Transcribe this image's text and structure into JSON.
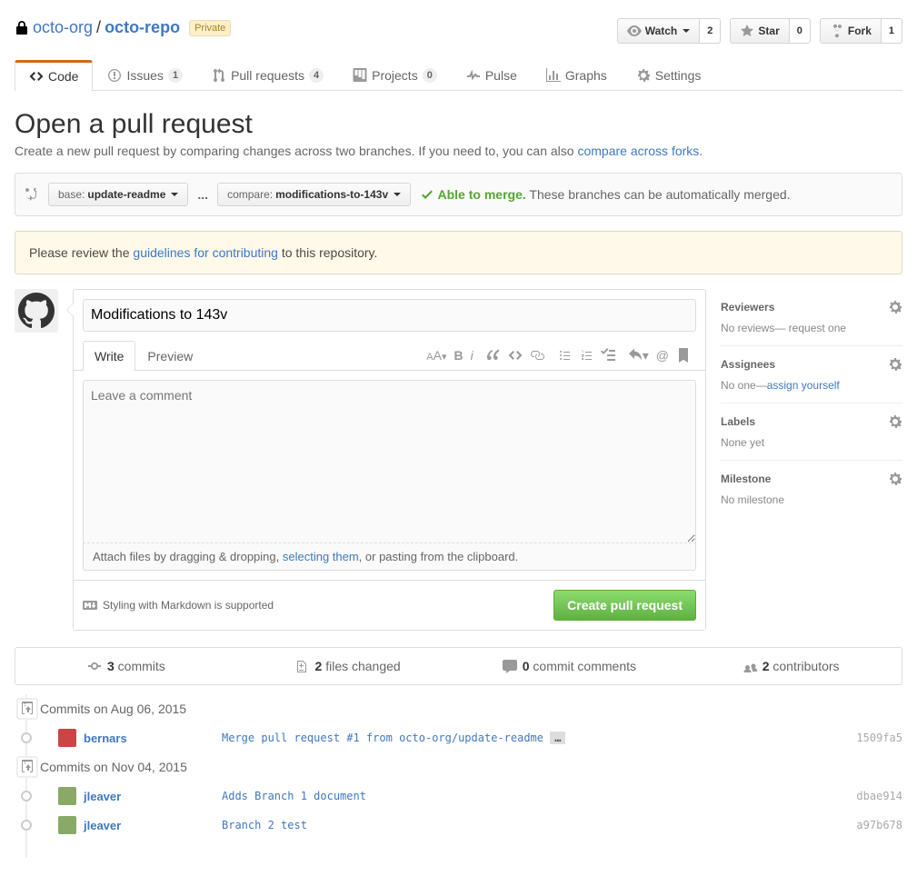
{
  "repo": {
    "owner": "octo-org",
    "name": "octo-repo",
    "privacy": "Private"
  },
  "actions": {
    "watch": {
      "label": "Watch",
      "count": "2"
    },
    "star": {
      "label": "Star",
      "count": "0"
    },
    "fork": {
      "label": "Fork",
      "count": "1"
    }
  },
  "nav": {
    "code": "Code",
    "issues": {
      "label": "Issues",
      "count": "1"
    },
    "pulls": {
      "label": "Pull requests",
      "count": "4"
    },
    "projects": {
      "label": "Projects",
      "count": "0"
    },
    "pulse": "Pulse",
    "graphs": "Graphs",
    "settings": "Settings"
  },
  "page": {
    "title": "Open a pull request",
    "subtitle_a": "Create a new pull request by comparing changes across two branches. If you need to, you can also ",
    "subtitle_link": "compare across forks",
    "subtitle_b": "."
  },
  "range": {
    "base_label": "base:",
    "base_value": "update-readme",
    "compare_label": "compare:",
    "compare_value": "modifications-to-143v",
    "dots": "...",
    "merge_ok": "Able to merge.",
    "merge_msg": "These branches can be automatically merged."
  },
  "flash": {
    "a": "Please review the ",
    "link": "guidelines for contributing",
    "b": " to this repository."
  },
  "form": {
    "title_value": "Modifications to 143v",
    "tab_write": "Write",
    "tab_preview": "Preview",
    "placeholder": "Leave a comment",
    "drag_a": "Attach files by dragging & dropping, ",
    "drag_link": "selecting them",
    "drag_b": ", or pasting from the clipboard.",
    "md_hint": "Styling with Markdown is supported",
    "submit": "Create pull request"
  },
  "sidebar": {
    "reviewers": {
      "title": "Reviewers",
      "body": "No reviews— request one"
    },
    "assignees": {
      "title": "Assignees",
      "body_a": "No one—",
      "body_link": "assign yourself"
    },
    "labels": {
      "title": "Labels",
      "body": "None yet"
    },
    "milestone": {
      "title": "Milestone",
      "body": "No milestone"
    }
  },
  "diffstat": {
    "commits": {
      "n": "3",
      "label": " commits"
    },
    "files": {
      "n": "2",
      "label": " files changed"
    },
    "comments": {
      "n": "0",
      "label": " commit comments"
    },
    "contributors": {
      "n": "2",
      "label": " contributors"
    }
  },
  "commits": {
    "g1": {
      "head": "Commits on Aug 06, 2015",
      "r1": {
        "author": "bernars",
        "msg": "Merge pull request #1 from octo-org/update-readme",
        "sha": "1509fa5"
      }
    },
    "g2": {
      "head": "Commits on Nov 04, 2015",
      "r1": {
        "author": "jleaver",
        "msg": "Adds Branch 1 document",
        "sha": "dbae914"
      },
      "r2": {
        "author": "jleaver",
        "msg": "Branch 2 test",
        "sha": "a97b678"
      }
    }
  }
}
